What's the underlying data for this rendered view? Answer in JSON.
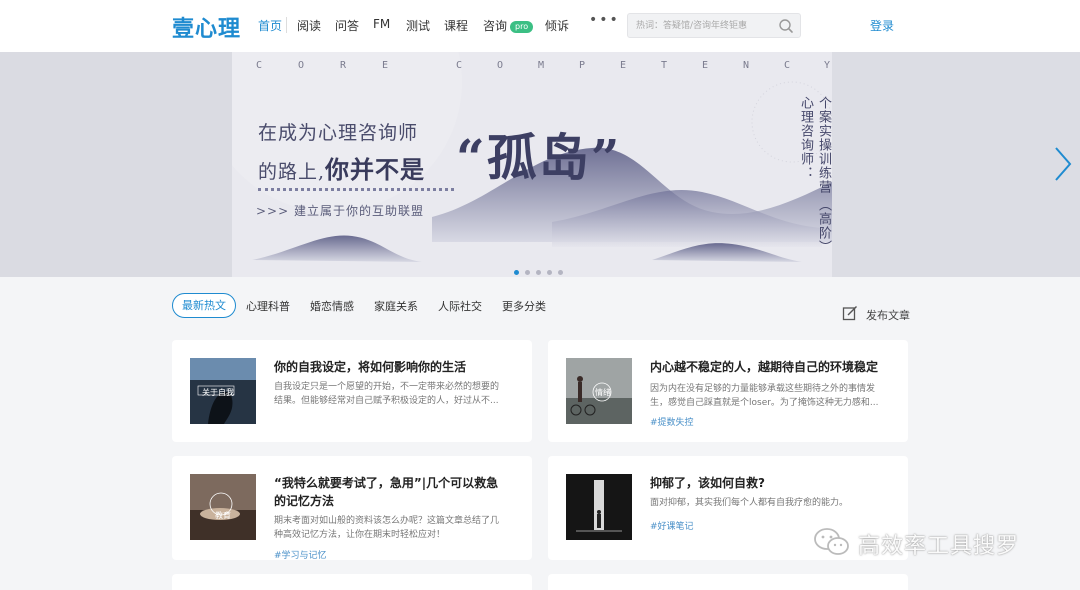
{
  "nav": {
    "logo": "壹心理",
    "items": [
      {
        "label": "首页",
        "active": true
      },
      {
        "label": "阅读"
      },
      {
        "label": "问答"
      },
      {
        "label": "FM"
      },
      {
        "label": "测试"
      },
      {
        "label": "课程"
      },
      {
        "label": "咨询",
        "badge": "pro"
      },
      {
        "label": "倾诉"
      }
    ],
    "more": "•••",
    "search_placeholder": "热词：答疑馆/咨询年终钜惠",
    "login": "登录"
  },
  "banner": {
    "letters": [
      "C",
      "O",
      "R",
      "E",
      "C",
      "O",
      "M",
      "P",
      "E",
      "T",
      "E",
      "N",
      "C",
      "Y"
    ],
    "line1": "在成为心理咨询师",
    "line2_prefix": "的路上,",
    "line2_bold": "你并不是",
    "big_title": "“孤岛”",
    "slogan": ">>> 建立属于你的互助联盟",
    "vertical_col1": "个案实操训练营",
    "vertical_col2": "心理咨询师：",
    "vertical_col3": "（高阶）",
    "slides_total": 5,
    "slide_active": 1
  },
  "tabs": {
    "items": [
      "最新热文",
      "心理科普",
      "婚恋情感",
      "家庭关系",
      "人际社交",
      "更多分类"
    ],
    "publish": "发布文章"
  },
  "cards": [
    {
      "title": "你的自我设定，将如何影响你的生活",
      "desc": "自我设定只是一个愿望的开始，不一定带来必然的想要的结果。但能够经常对自己赋予积极设定的人，好过从不...",
      "tag": "",
      "thumb_label": "关于自我"
    },
    {
      "title": "内心越不稳定的人，越期待自己的环境稳定",
      "desc": "因为内在没有足够的力量能够承载这些期待之外的事情发生，感觉自己踩直就是个loser。为了掩饰这种无力感和...",
      "tag": "#提数失控",
      "thumb_label": "情绪"
    },
    {
      "title": "“我特么就要考试了，急用”|几个可以救急的记忆方法",
      "desc": "期末考面对如山般的资料该怎么办呢？这篇文章总结了几种高效记忆方法，让你在期末时轻松应对！",
      "tag": "#学习与记忆",
      "thumb_label": "教育"
    },
    {
      "title": "抑郁了，该如何自救?",
      "desc": "面对抑郁，其实我们每个人都有自我疗愈的能力。",
      "tag": "#好课笔记",
      "thumb_label": ""
    }
  ],
  "watermark": "高效率工具搜罗",
  "colors": {
    "brand": "#1f8bd0",
    "pro_badge": "#3bbf84",
    "tag": "#4a90c8"
  }
}
